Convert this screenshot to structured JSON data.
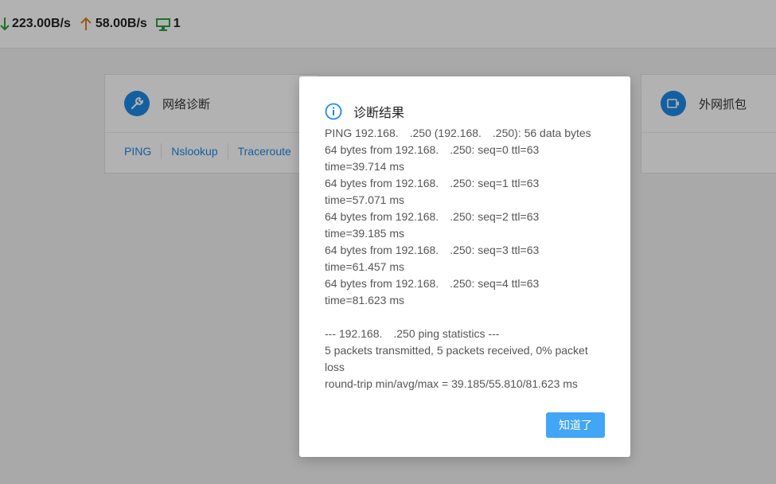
{
  "status": {
    "download": "223.00B/s",
    "upload": "58.00B/s",
    "devices": "1"
  },
  "cards": [
    {
      "title": "网络诊断",
      "icon": "wrench-icon",
      "links": [
        "PING",
        "Nslookup",
        "Traceroute"
      ]
    },
    {
      "title": "外网抓包",
      "icon": "camera-icon"
    }
  ],
  "dialog": {
    "title": "诊断结果",
    "icon": "info-icon",
    "lines": [
      "PING 192.168.  .250 (192.168.  .250): 56 data bytes",
      "64 bytes from 192.168.  .250: seq=0 ttl=63",
      "time=39.714 ms",
      "64 bytes from 192.168.  .250: seq=1 ttl=63",
      "time=57.071 ms",
      "64 bytes from 192.168.  .250: seq=2 ttl=63",
      "time=39.185 ms",
      "64 bytes from 192.168.  .250: seq=3 ttl=63",
      "time=61.457 ms",
      "64 bytes from 192.168.  .250: seq=4 ttl=63",
      "time=81.623 ms",
      "",
      "--- 192.168.  .250 ping statistics ---",
      "5 packets transmitted, 5 packets received, 0% packet",
      "loss",
      "round-trip min/avg/max = 39.185/55.810/81.623 ms"
    ],
    "ok_label": "知道了"
  },
  "colors": {
    "accent": "#1e88e5",
    "button": "#42a5f5",
    "download": "#2e9e3e",
    "upload": "#e07b1e"
  }
}
